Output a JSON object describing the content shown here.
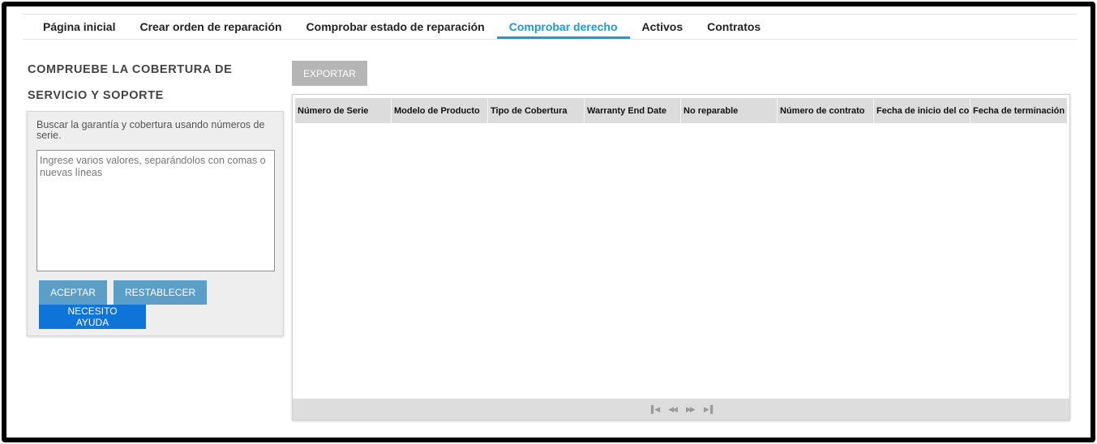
{
  "nav": {
    "items": [
      {
        "label": "Página inicial",
        "active": false
      },
      {
        "label": "Crear orden de reparación",
        "active": false
      },
      {
        "label": "Comprobar estado de reparación",
        "active": false
      },
      {
        "label": "Comprobar derecho",
        "active": true
      },
      {
        "label": "Activos",
        "active": false
      },
      {
        "label": "Contratos",
        "active": false
      }
    ]
  },
  "left": {
    "title_line1": "COMPRUEBE LA COBERTURA DE",
    "title_line2": "SERVICIO Y SOPORTE",
    "help_text": "Buscar la garantía y cobertura usando números de serie.",
    "textarea_placeholder": "Ingrese varios valores, separándolos con comas o nuevas líneas",
    "textarea_value": "",
    "accept_label": "ACEPTAR",
    "reset_label": "RESTABLECER",
    "help_button_label": "NECESITO AYUDA"
  },
  "toolbar": {
    "export_label": "EXPORTAR"
  },
  "grid": {
    "columns": [
      "Número de Serie",
      "Modelo de Producto",
      "Tipo de Cobertura",
      "Warranty End Date",
      "No reparable",
      "Número de contrato",
      "Fecha de inicio del contrato",
      "Fecha de terminación"
    ],
    "rows": []
  },
  "pager": {
    "icons": [
      "first-page-icon",
      "previous-page-icon",
      "next-page-icon",
      "last-page-icon"
    ]
  },
  "colors": {
    "active_tab": "#1a9ad6",
    "button": "#5b9fc9",
    "help_button": "#0f74d8",
    "export_disabled": "#b5b5b5"
  }
}
